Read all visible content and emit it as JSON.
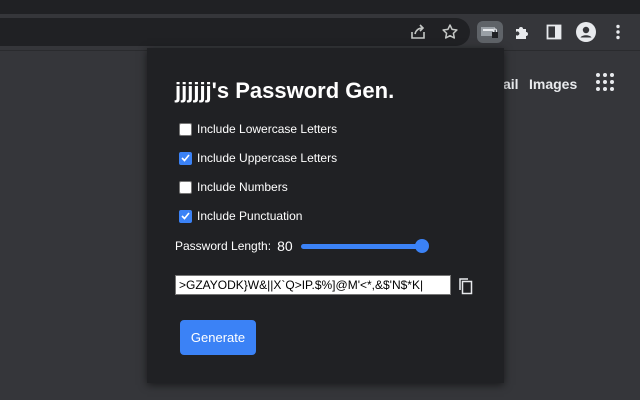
{
  "browser": {
    "toolbar_icons": [
      "share-icon",
      "star-icon",
      "password-extension-icon",
      "extensions-puzzle-icon",
      "side-panel-icon",
      "profile-avatar-icon",
      "more-vertical-icon"
    ]
  },
  "page": {
    "link_gmail": "ail",
    "link_images": "Images",
    "apps_icon": "apps-grid-icon"
  },
  "popup": {
    "title": "jjjjjj's Password Gen.",
    "options": [
      {
        "label": "Include Lowercase Letters",
        "checked": false
      },
      {
        "label": "Include Uppercase Letters",
        "checked": true
      },
      {
        "label": "Include Numbers",
        "checked": false
      },
      {
        "label": "Include Punctuation",
        "checked": true
      }
    ],
    "length_label": "Password Length:",
    "length_value": "80",
    "slider_fraction": 1.0,
    "password": ">GZAYODK}W&||X`Q>IP.$%]@M'<*,&$'N$*K|",
    "copy_icon": "copy-icon",
    "generate_label": "Generate"
  },
  "colors": {
    "accent": "#3b82f6",
    "popup_bg": "#202124",
    "page_bg": "#35363a"
  }
}
